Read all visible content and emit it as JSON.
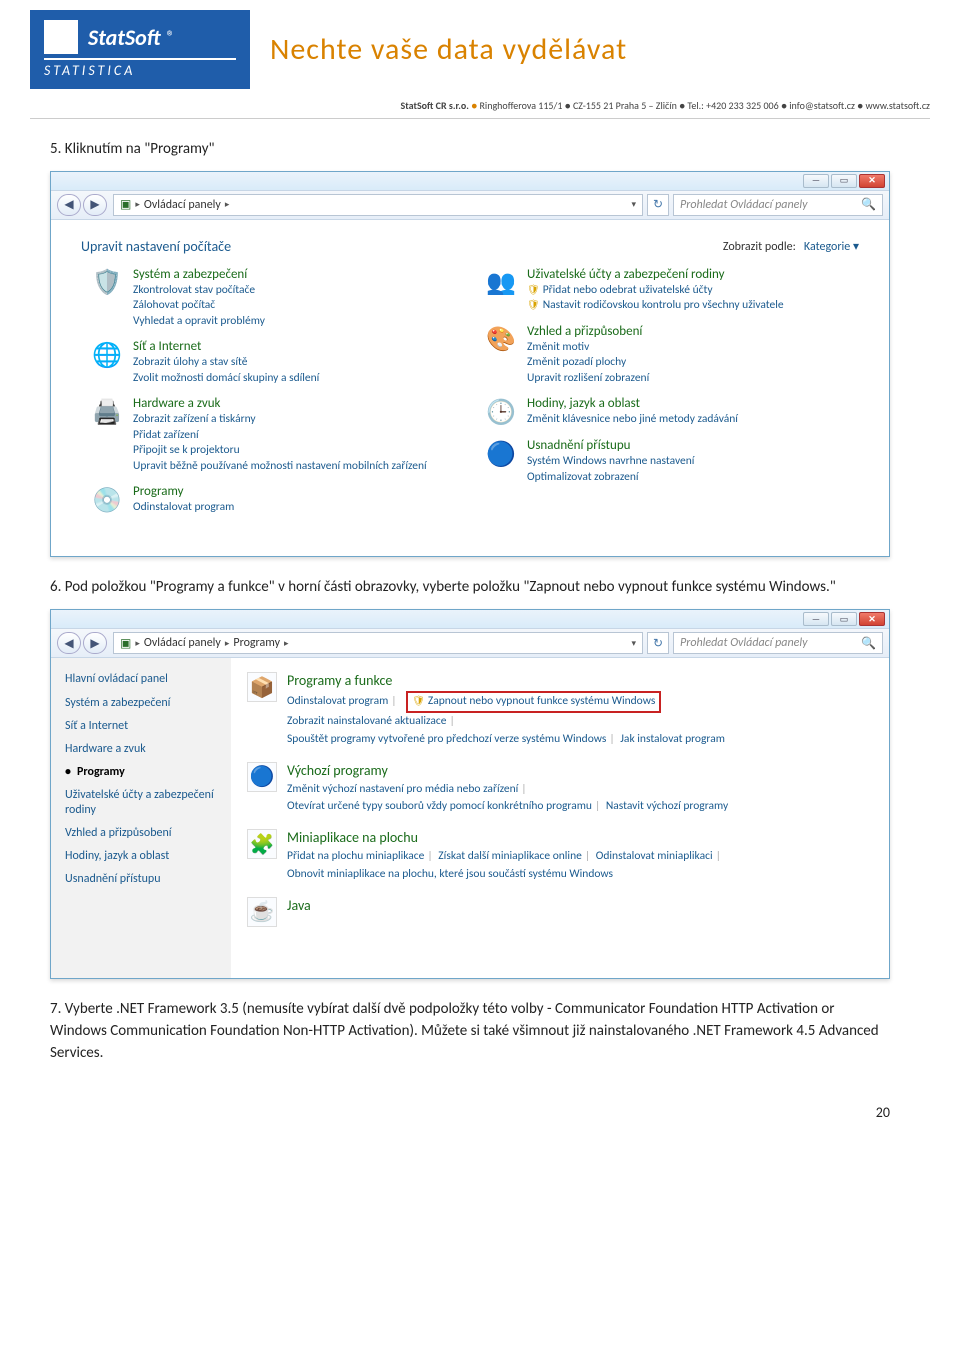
{
  "header": {
    "logo_title": "StatSoft",
    "logo_sub": "STATISTICA",
    "slogan": "Nechte vaše data vydělávat",
    "contact_company": "StatSoft CR s.r.o.",
    "contact_rest": " Ringhofferova 115/1 ● CZ-155 21 Praha 5 – Zličín ● Tel.: +420 233 325 006 ● info@statsoft.cz ● www.statsoft.cz"
  },
  "step5": "5.   Kliknutím na \"Programy\"",
  "win1": {
    "crumb": "Ovládací panely",
    "search_ph": "Prohledat Ovládací panely",
    "title": "Upravit nastavení počítače",
    "view_lbl": "Zobrazit podle:",
    "view_val": "Kategorie ▾",
    "left": [
      {
        "h": "Systém a zabezpečení",
        "links": [
          "Zkontrolovat stav počítače",
          "Zálohovat počítač",
          "Vyhledat a opravit problémy"
        ]
      },
      {
        "h": "Síť a Internet",
        "links": [
          "Zobrazit úlohy a stav sítě",
          "Zvolit možnosti domácí skupiny a sdílení"
        ]
      },
      {
        "h": "Hardware a zvuk",
        "links": [
          "Zobrazit zařízení a tiskárny",
          "Přidat zařízení",
          "Připojit se k projektoru",
          "Upravit běžně používané možnosti nastavení mobilních zařízení"
        ]
      },
      {
        "h": "Programy",
        "links": [
          "Odinstalovat program"
        ]
      }
    ],
    "right": [
      {
        "h": "Uživatelské účty a zabezpečení rodiny",
        "links": [
          {
            "t": "Přidat nebo odebrat uživatelské účty",
            "s": true
          },
          {
            "t": "Nastavit rodičovskou kontrolu pro všechny uživatele",
            "s": true
          }
        ]
      },
      {
        "h": "Vzhled a přizpůsobení",
        "links": [
          "Změnit motiv",
          "Změnit pozadí plochy",
          "Upravit rozlišení zobrazení"
        ]
      },
      {
        "h": "Hodiny, jazyk a oblast",
        "links": [
          "Změnit klávesnice nebo jiné metody zadávání"
        ]
      },
      {
        "h": "Usnadnění přístupu",
        "links": [
          "Systém Windows navrhne nastavení",
          "Optimalizovat zobrazení"
        ]
      }
    ]
  },
  "step6": "6.   Pod položkou \"Programy a funkce\" v horní části obrazovky, vyberte položku \"Zapnout nebo vypnout funkce systému Windows.\"",
  "win2": {
    "crumb1": "Ovládací panely",
    "crumb2": "Programy",
    "search_ph": "Prohledat Ovládací panely",
    "side_main": "Hlavní ovládací panel",
    "side_items": [
      "Systém a zabezpečení",
      "Síť a Internet",
      "Hardware a zvuk",
      "Programy",
      "Uživatelské účty a zabezpečení rodiny",
      "Vzhled a přizpůsobení",
      "Hodiny, jazyk a oblast",
      "Usnadnění přístupu"
    ],
    "sec1_h": "Programy a funkce",
    "sec1_link1": "Odinstalovat program",
    "sec1_hl": "Zapnout nebo vypnout funkce systému Windows",
    "sec1_link3": "Zobrazit nainstalované aktualizace",
    "sec1_link4": "Spouštět programy vytvořené pro předchozí verze systému Windows",
    "sec1_link5": "Jak instalovat program",
    "sec2_h": "Výchozí programy",
    "sec2_link1": "Změnit výchozí nastavení pro média nebo zařízení",
    "sec2_link2": "Otevírat určené typy souborů vždy pomocí konkrétního programu",
    "sec2_link3": "Nastavit výchozí programy",
    "sec3_h": "Miniaplikace na plochu",
    "sec3_link1": "Přidat na plochu miniaplikace",
    "sec3_link2": "Získat další miniaplikace online",
    "sec3_link3": "Odinstalovat miniaplikaci",
    "sec3_link4": "Obnovit miniaplikace na plochu, které jsou součástí systému Windows",
    "sec4_h": "Java"
  },
  "step7": "7.   Vyberte  .NET Framework 3.5 (nemusíte vybírat další dvě podpoložky této volby - Communicator Foundation HTTP Activation or Windows Communication Foundation Non-HTTP Activation).  Můžete si také všimnout  již nainstalovaného .NET Framework 4.5 Advanced Services.",
  "page_num": "20"
}
